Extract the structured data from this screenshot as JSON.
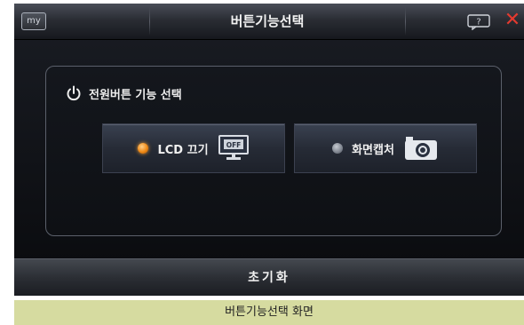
{
  "titlebar": {
    "my_label": "my",
    "title": "버튼기능선택",
    "help_icon": "help-speech-bubble-icon",
    "close_label": "✕",
    "close_color": "#e33a2f"
  },
  "panel": {
    "icon": "power-icon",
    "title": "전원버튼 기능 선택",
    "options": [
      {
        "label": "LCD 끄기",
        "selected": true,
        "icon": "monitor-off-icon",
        "icon_text": "OFF"
      },
      {
        "label": "화면캡처",
        "selected": false,
        "icon": "camera-icon"
      }
    ]
  },
  "bottombar": {
    "reset_label": "초기화"
  },
  "caption": "버튼기능선택 화면",
  "colors": {
    "accent_selected": "#f08a16",
    "caption_bg": "#d6dba0"
  }
}
